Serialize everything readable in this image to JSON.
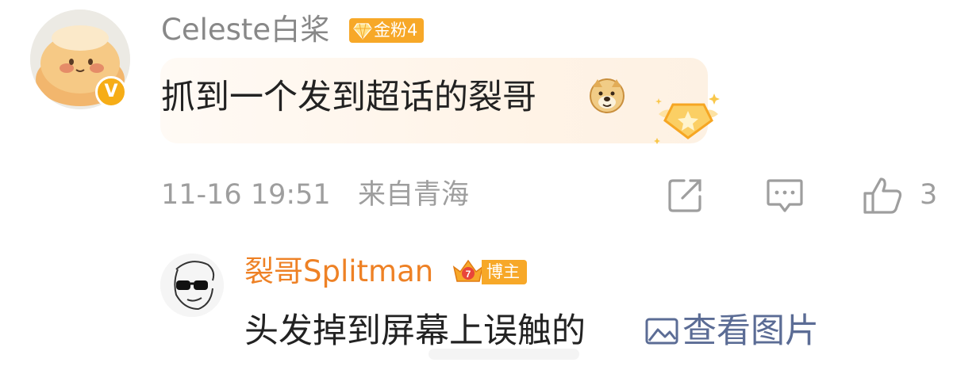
{
  "comment_main": {
    "username": "Celeste白桨",
    "fan_badge": "金粉4",
    "content": "抓到一个发到超话的裂哥",
    "verified_glyph": "V",
    "timestamp": "11-16 19:51",
    "location": "来自青海",
    "like_count": "3",
    "icons": [
      "avatar-image",
      "verified-badge",
      "doge-emoji",
      "gold-fan-decoration",
      "share-icon",
      "comment-icon",
      "like-icon"
    ]
  },
  "reply": {
    "username": "裂哥Splitman",
    "badge_level": "7",
    "badge_label": "博主",
    "content": "头发掉到屏幕上误触的",
    "view_image_label": "查看图片",
    "icons": [
      "avatar-image",
      "crown-badge-icon",
      "image-icon"
    ]
  },
  "colors": {
    "username_gray": "#888888",
    "blogger_orange": "#ee8125",
    "badge_gold": "#f7a828",
    "link_blue": "#5b6c95",
    "meta_gray": "#9e9e9e"
  }
}
